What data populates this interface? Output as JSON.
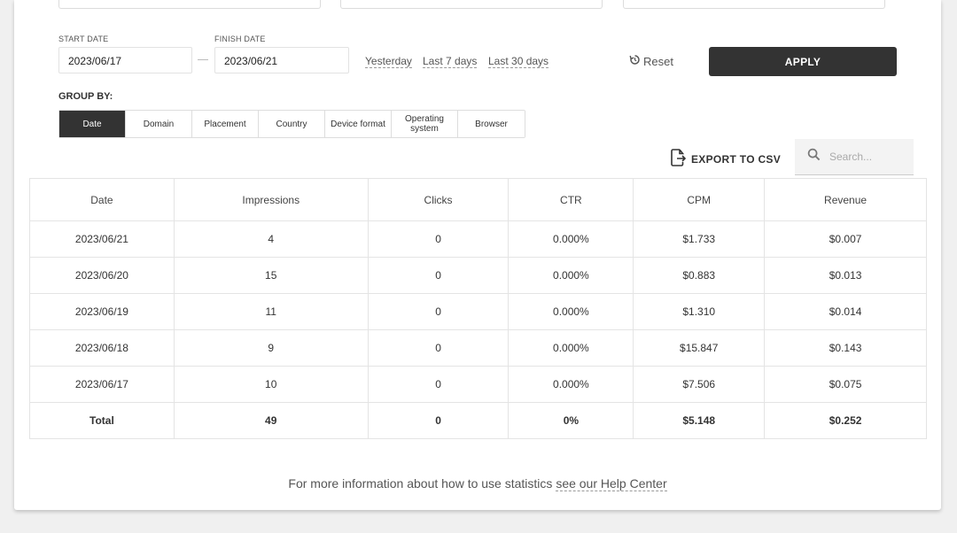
{
  "filters": {
    "start_label": "START DATE",
    "start_value": "2023/06/17",
    "finish_label": "FINISH DATE",
    "finish_value": "2023/06/21",
    "quick_ranges": [
      "Yesterday",
      "Last 7 days",
      "Last 30 days"
    ],
    "reset_label": "Reset",
    "apply_label": "APPLY"
  },
  "group_by": {
    "label": "GROUP BY:",
    "options": [
      "Date",
      "Domain",
      "Placement",
      "Country",
      "Device format",
      "Operating system",
      "Browser"
    ],
    "active": "Date"
  },
  "toolbar": {
    "export_label": "EXPORT TO CSV",
    "search_placeholder": "Search..."
  },
  "table": {
    "columns": [
      "Date",
      "Impressions",
      "Clicks",
      "CTR",
      "CPM",
      "Revenue"
    ],
    "rows": [
      [
        "2023/06/21",
        "4",
        "0",
        "0.000%",
        "$1.733",
        "$0.007"
      ],
      [
        "2023/06/20",
        "15",
        "0",
        "0.000%",
        "$0.883",
        "$0.013"
      ],
      [
        "2023/06/19",
        "11",
        "0",
        "0.000%",
        "$1.310",
        "$0.014"
      ],
      [
        "2023/06/18",
        "9",
        "0",
        "0.000%",
        "$15.847",
        "$0.143"
      ],
      [
        "2023/06/17",
        "10",
        "0",
        "0.000%",
        "$7.506",
        "$0.075"
      ]
    ],
    "total": [
      "Total",
      "49",
      "0",
      "0%",
      "$5.148",
      "$0.252"
    ]
  },
  "footer": {
    "text": "For more information about how to use statistics",
    "link": "see our Help Center"
  },
  "icons": {
    "reset": "reset-icon",
    "export": "export-file-icon",
    "search": "search-icon"
  }
}
